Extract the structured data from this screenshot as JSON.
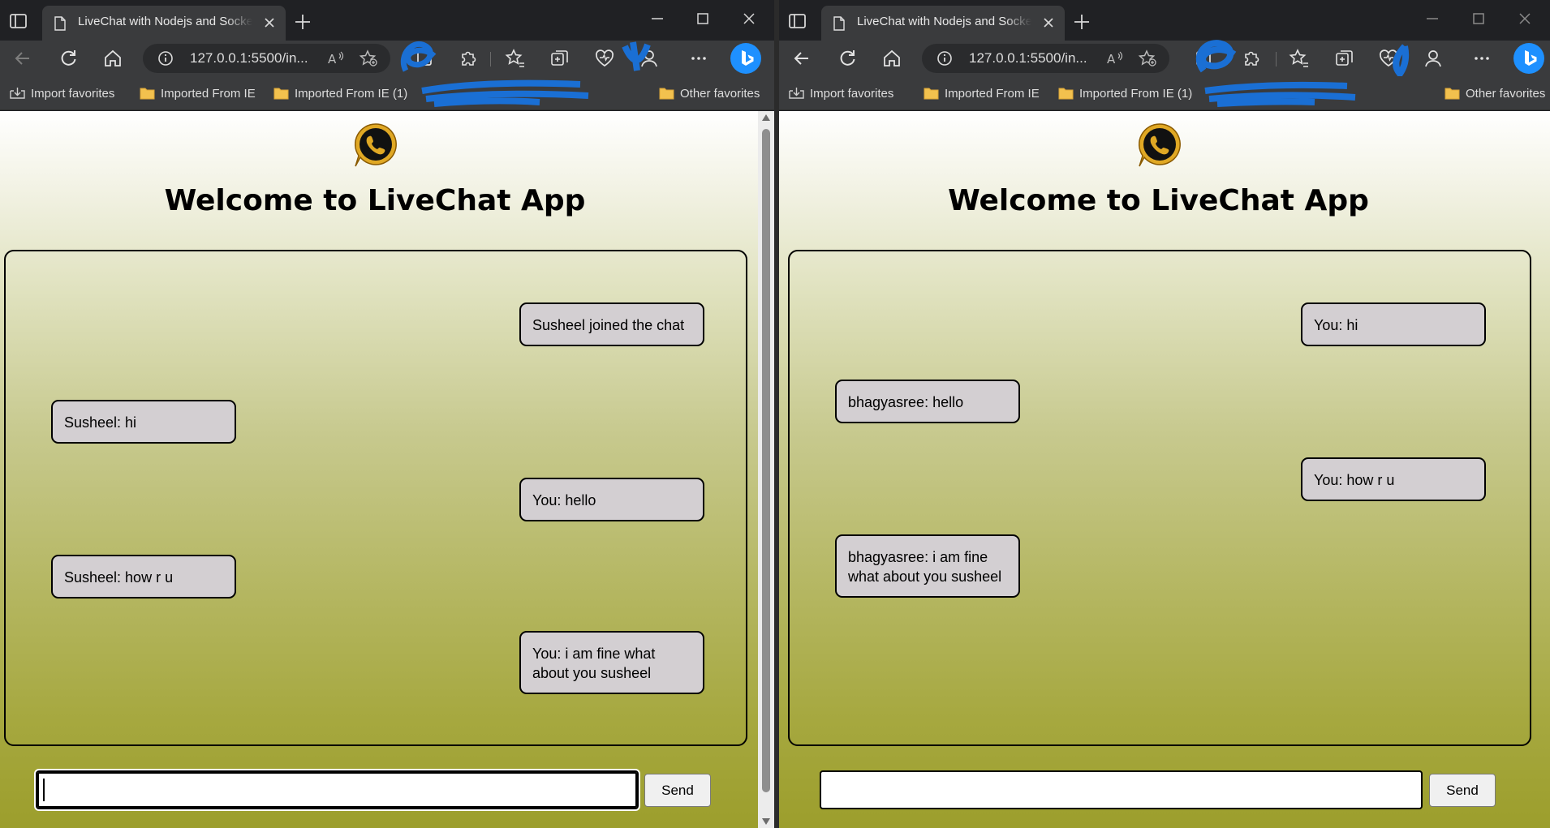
{
  "browser": {
    "tab_title": "LiveChat with Nodejs and Socket.io",
    "url": "127.0.0.1:5500/in...",
    "read_aloud_label": "A",
    "favorites": [
      "Import favorites",
      "Imported From IE",
      "Imported From IE (1)"
    ],
    "other_favorites": "Other favorites",
    "colors": {
      "frame": "#202124",
      "toolbar": "#3a3b3d",
      "bing": "#1e90ff"
    }
  },
  "app": {
    "title": "Welcome to LiveChat App",
    "send_label": "Send",
    "input_value": "",
    "colors": {
      "bubble": "#d3cfd2",
      "gradient_top": "#ffffff",
      "gradient_bottom": "#9c9e2c"
    }
  },
  "left_window": {
    "messages": [
      {
        "text": "Susheel joined the chat",
        "side": "right"
      },
      {
        "text": "Susheel: hi",
        "side": "left"
      },
      {
        "text": "You: hello",
        "side": "right"
      },
      {
        "text": "Susheel: how r u",
        "side": "left"
      },
      {
        "text": "You: i am fine what about you susheel",
        "side": "right"
      }
    ]
  },
  "right_window": {
    "messages": [
      {
        "text": "You: hi",
        "side": "right"
      },
      {
        "text": "bhagyasree: hello",
        "side": "left"
      },
      {
        "text": "You: how r u",
        "side": "right"
      },
      {
        "text": "bhagyasree: i am fine what about you susheel",
        "side": "left"
      }
    ]
  }
}
